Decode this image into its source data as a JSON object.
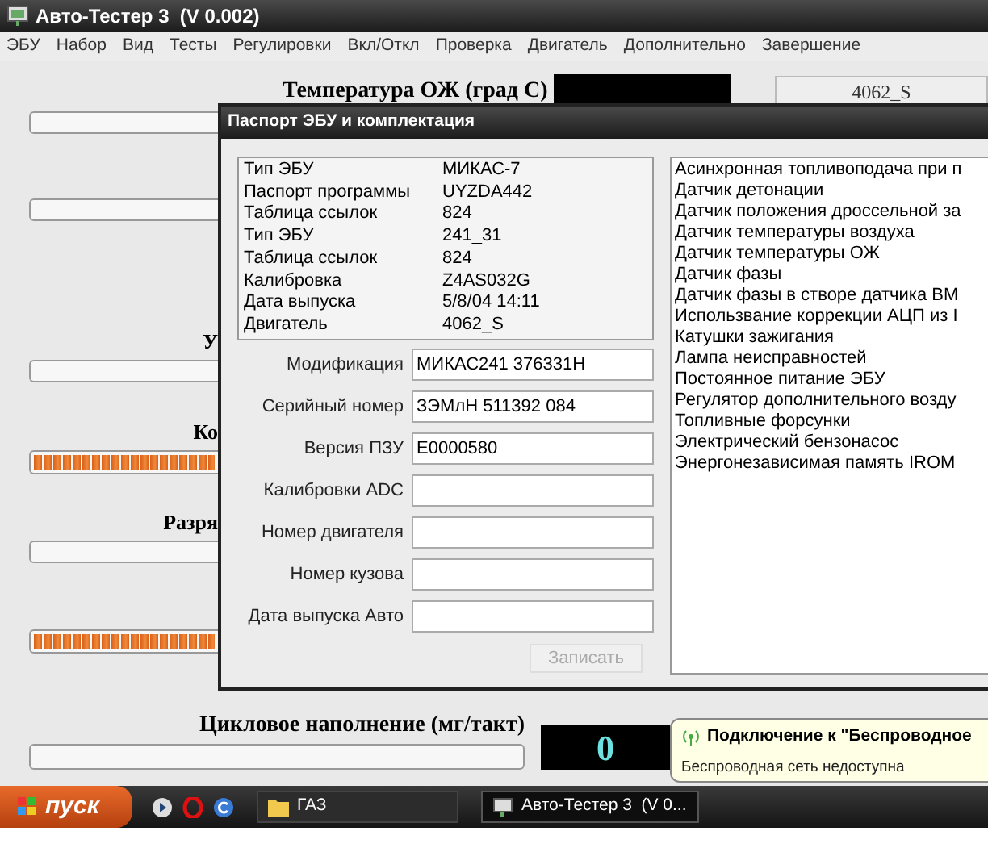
{
  "window": {
    "title": "Авто-Тестер 3  (V 0.002)"
  },
  "menu": [
    "ЭБУ",
    "Набор",
    "Вид",
    "Тесты",
    "Регулировки",
    "Вкл/Откл",
    "Проверка",
    "Двигатель",
    "Дополнительно",
    "Завершение"
  ],
  "main": {
    "top_label": "Температура ОЖ (град С)",
    "engine_code": "4062_S",
    "rows": [
      {
        "kind": "field"
      },
      {
        "kind": "field"
      },
      {
        "kind": "field",
        "label": "У"
      },
      {
        "kind": "meter",
        "label": "Ко",
        "level": 1
      },
      {
        "kind": "field",
        "label": "Разря"
      },
      {
        "kind": "meter",
        "level": 1
      }
    ],
    "cycle": {
      "label": "Цикловое наполнение (мг/такт)",
      "reading": "0"
    }
  },
  "dialog": {
    "title": "Паспорт ЭБУ и комплектация",
    "info": [
      {
        "label": "Тип ЭБУ",
        "value": "МИКАС-7"
      },
      {
        "label": "Паспорт программы",
        "value": "UYZDA442"
      },
      {
        "label": "Таблица ссылок",
        "value": "824"
      },
      {
        "label": "Тип ЭБУ",
        "value": "241_31"
      },
      {
        "label": "Таблица ссылок",
        "value": "824"
      },
      {
        "label": "Калибровка",
        "value": "Z4AS032G"
      },
      {
        "label": "Дата выпуска",
        "value": "5/8/04 14:11"
      },
      {
        "label": "Двигатель",
        "value": "4062_S"
      }
    ],
    "fields": [
      {
        "label": "Модификация",
        "value": "МИКАС241 376331H"
      },
      {
        "label": "Серийный номер",
        "value": "ЗЭМлН 511392 084"
      },
      {
        "label": "Версия ПЗУ",
        "value": "E0000580"
      },
      {
        "label": "Калибровки ADC"
      },
      {
        "label": "Номер двигателя"
      },
      {
        "label": "Номер кузова"
      },
      {
        "label": "Дата выпуска Авто"
      }
    ],
    "button": {
      "label": "Записать",
      "disabled": true
    },
    "list": [
      "Асинхронная топливоподача при п",
      "Датчик детонации",
      "Датчик положения дроссельной за",
      "Датчик температуры воздуха",
      "Датчик температуры ОЖ",
      "Датчик фазы",
      "Датчик фазы в створе датчика ВМ",
      "Использвание коррекции АЦП из I",
      "Катушки зажигания",
      "Лампа неисправностей",
      "Постоянное питание ЭБУ",
      "Регулятор дополнительного возду",
      "Топливные форсунки",
      "Электрический бензонасос",
      "Энергонезависимая память IROM"
    ]
  },
  "balloon": {
    "title": "Подключение к \"Беспроводное",
    "text": "Беспроводная сеть недоступна"
  },
  "taskbar": {
    "start": "пуск",
    "tasks": [
      {
        "label": "ГАЗ",
        "selected": false
      },
      {
        "label": "Авто-Тестер 3  (V 0...",
        "selected": true
      }
    ]
  }
}
